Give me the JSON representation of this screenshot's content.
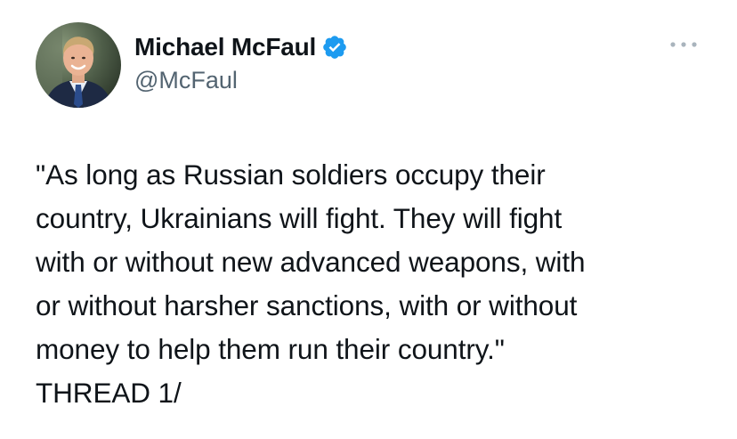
{
  "author": {
    "display_name": "Michael McFaul",
    "handle": "@McFaul",
    "verified": true,
    "verified_color": "#1d9bf0"
  },
  "icons": {
    "avatar": "profile-photo",
    "verified": "verified-badge-icon",
    "more": "more-options-icon"
  },
  "tweet": {
    "lines": [
      "\"As long as Russian soldiers occupy their",
      "country, Ukrainians will fight. They will fight",
      "with or without new advanced weapons, with",
      "or without harsher sanctions, with or without",
      "money to help them run their country.\"",
      "THREAD 1/"
    ]
  },
  "colors": {
    "text": "#0f1419",
    "secondary": "#536471",
    "background": "#ffffff"
  }
}
